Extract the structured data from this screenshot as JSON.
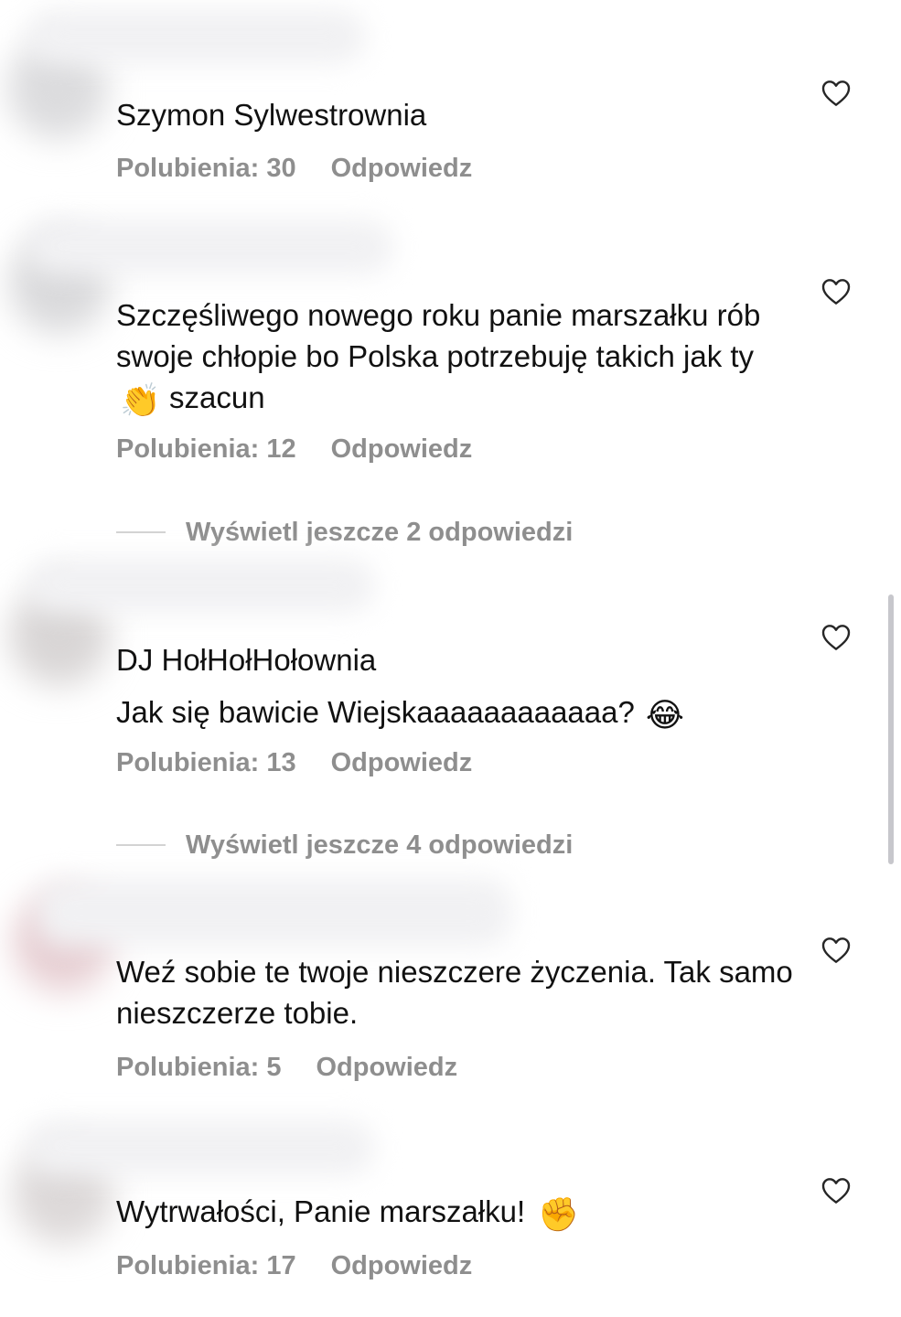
{
  "comments": [
    {
      "username": "Szymon Sylwestrownia",
      "text": "",
      "likes_label": "Polubienia: 30",
      "reply_label": "Odpowiedz"
    },
    {
      "username": "",
      "text": "Szczęśliwego nowego roku panie marszałku rób swoje chłopie bo Polska potrzebuję takich jak ty",
      "text_after_emoji": " szacun",
      "emoji": "👏",
      "likes_label": "Polubienia: 12",
      "reply_label": "Odpowiedz",
      "view_replies_label": "Wyświetl jeszcze 2 odpowiedzi"
    },
    {
      "username": "DJ HołHołHołownia",
      "text": "Jak się bawicie Wiejskaaaaaaaaaaaa?",
      "emoji": "😂",
      "likes_label": "Polubienia: 13",
      "reply_label": "Odpowiedz",
      "view_replies_label": "Wyświetl jeszcze 4 odpowiedzi"
    },
    {
      "username": "",
      "text": "Weź sobie te twoje nieszczere życzenia. Tak samo nieszczerze tobie.",
      "likes_label": "Polubienia: 5",
      "reply_label": "Odpowiedz"
    },
    {
      "username": "",
      "text": "Wytrwałości, Panie marszałku!",
      "emoji": "✊",
      "likes_label": "Polubienia: 17",
      "reply_label": "Odpowiedz"
    }
  ],
  "icons": {
    "like": "heart-outline-icon"
  },
  "colors": {
    "text": "#111111",
    "meta": "#8e8e8e",
    "divider": "#d3d3d3",
    "scrollbar": "#c7c7cc"
  }
}
